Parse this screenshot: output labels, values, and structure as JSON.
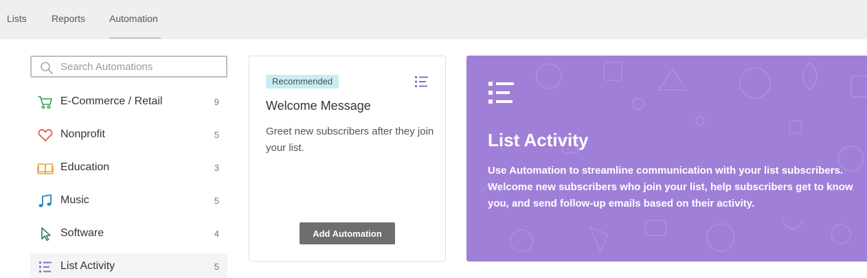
{
  "nav": {
    "tabs": [
      {
        "label": "Lists"
      },
      {
        "label": "Reports"
      },
      {
        "label": "Automation",
        "active": true
      }
    ]
  },
  "sidebar": {
    "search_placeholder": "Search Automations",
    "categories": [
      {
        "label": "E-Commerce / Retail",
        "count": "9",
        "icon": "shopping-cart-icon",
        "color": "#3a9a4a"
      },
      {
        "label": "Nonprofit",
        "count": "5",
        "icon": "heart-icon",
        "color": "#e0553b"
      },
      {
        "label": "Education",
        "count": "3",
        "icon": "book-icon",
        "color": "#e8a23a"
      },
      {
        "label": "Music",
        "count": "5",
        "icon": "music-note-icon",
        "color": "#2a85c2"
      },
      {
        "label": "Software",
        "count": "4",
        "icon": "cursor-icon",
        "color": "#2f7a6c"
      },
      {
        "label": "List Activity",
        "count": "5",
        "icon": "list-icon",
        "color": "#8a6dc9",
        "active": true
      }
    ]
  },
  "card": {
    "badge": "Recommended",
    "title": "Welcome Message",
    "description": "Greet new subscribers after they join your list.",
    "button": "Add Automation",
    "icon": "list-icon"
  },
  "hero": {
    "title": "List Activity",
    "body": "Use Automation to streamline communication with your list subscribers. Welcome new subscribers who join your list, help subscribers get to know you, and send follow-up emails based on their activity.",
    "background": "#a07fd8",
    "icon": "list-icon"
  }
}
